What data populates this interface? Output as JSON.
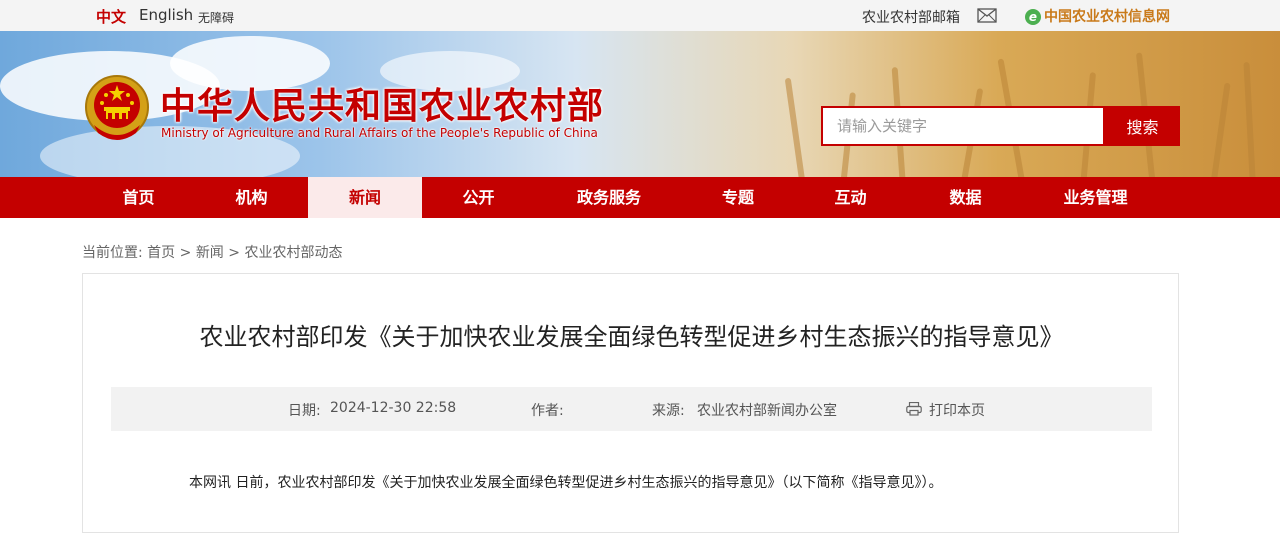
{
  "topbar": {
    "lang_zh": "中文",
    "lang_en": "English",
    "accessibility": "无障碍",
    "mailbox": "农业农村部邮箱",
    "info_network": "中国农业农村信息网",
    "info_network_icon_letter": "e"
  },
  "header": {
    "title": "中华人民共和国农业农村部",
    "subtitle": "Ministry of Agriculture and Rural Affairs of the People's Republic of China"
  },
  "search": {
    "placeholder": "请输入关键字",
    "button_label": "搜索"
  },
  "nav": {
    "items": [
      {
        "label": "首页"
      },
      {
        "label": "机构"
      },
      {
        "label": "新闻",
        "active": true
      },
      {
        "label": "公开"
      },
      {
        "label": "政务服务"
      },
      {
        "label": "专题"
      },
      {
        "label": "互动"
      },
      {
        "label": "数据"
      },
      {
        "label": "业务管理"
      }
    ]
  },
  "breadcrumb": {
    "prefix": "当前位置:",
    "items": [
      "首页",
      "新闻",
      "农业农村部动态"
    ],
    "separator": ">"
  },
  "article": {
    "title": "农业农村部印发《关于加快农业发展全面绿色转型促进乡村生态振兴的指导意见》",
    "date_label": "日期:",
    "date_value": "2024-12-30 22:58",
    "author_label": "作者:",
    "source_label": "来源:",
    "source_value": "农业农村部新闻办公室",
    "print_label": "打印本页",
    "lead": "本网讯 日前，农业农村部印发《关于加快农业发展全面绿色转型促进乡村生态振兴的指导意见》（以下简称《指导意见》）。"
  },
  "colors": {
    "brand_red": "#c40000",
    "nav_active_bg": "#fbeaea",
    "meta_bg": "#f2f2f2"
  }
}
